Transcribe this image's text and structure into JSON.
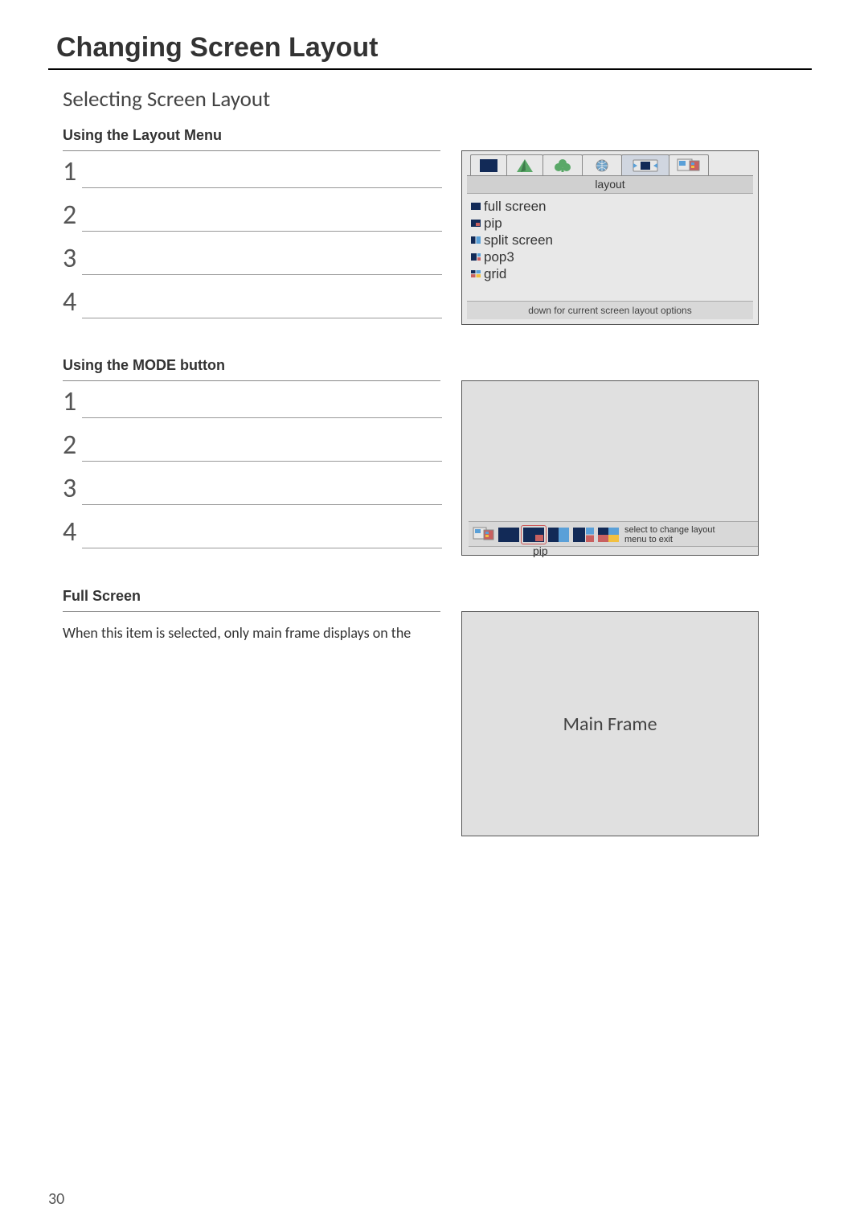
{
  "page": {
    "title": "Changing Screen Layout",
    "section_title": "Selecting Screen Layout",
    "page_number": "30"
  },
  "block1": {
    "heading": "Using the Layout Menu",
    "steps": [
      "1",
      "2",
      "3",
      "4"
    ],
    "osd": {
      "title": "layout",
      "items": [
        "full screen",
        "pip",
        "split screen",
        "pop3",
        "grid"
      ],
      "hint": "down for current screen layout options"
    }
  },
  "block2": {
    "heading": "Using the MODE button",
    "steps": [
      "1",
      "2",
      "3",
      "4"
    ],
    "osd": {
      "caption": "pip",
      "hint1": "select to change layout",
      "hint2": "menu to exit"
    }
  },
  "block3": {
    "heading": "Full Screen",
    "text": "When this item is selected, only main frame displays on the",
    "main_frame_label": "Main Frame"
  }
}
